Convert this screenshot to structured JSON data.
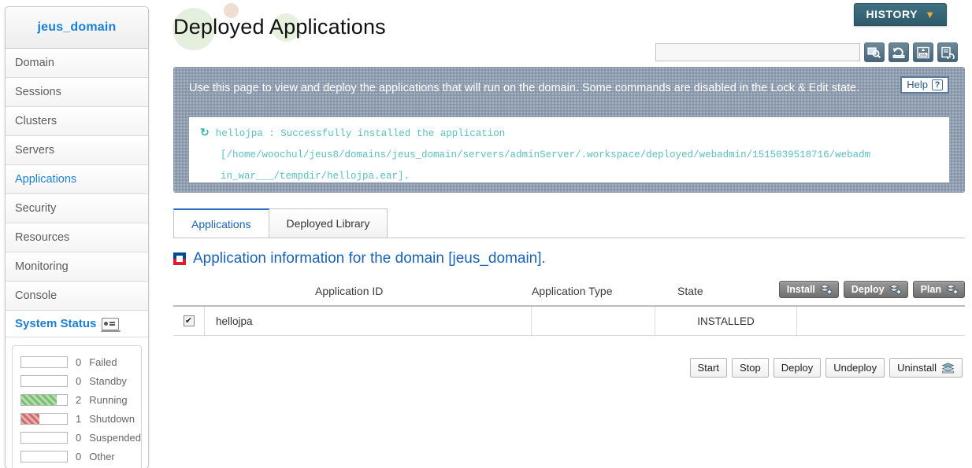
{
  "sidebar": {
    "domain_name": "jeus_domain",
    "items": [
      {
        "label": "Domain",
        "active": false
      },
      {
        "label": "Sessions",
        "active": false
      },
      {
        "label": "Clusters",
        "active": false
      },
      {
        "label": "Servers",
        "active": false
      },
      {
        "label": "Applications",
        "active": true
      },
      {
        "label": "Security",
        "active": false
      },
      {
        "label": "Resources",
        "active": false
      },
      {
        "label": "Monitoring",
        "active": false
      },
      {
        "label": "Console",
        "active": false
      }
    ],
    "system_status": {
      "title": "System Status",
      "rows": [
        {
          "count": "0",
          "label": "Failed",
          "fill_pct": 0,
          "color": ""
        },
        {
          "count": "0",
          "label": "Standby",
          "fill_pct": 0,
          "color": ""
        },
        {
          "count": "2",
          "label": "Running",
          "fill_pct": 78,
          "color": "green"
        },
        {
          "count": "1",
          "label": "Shutdown",
          "fill_pct": 40,
          "color": "red"
        },
        {
          "count": "0",
          "label": "Suspended",
          "fill_pct": 0,
          "color": ""
        },
        {
          "count": "0",
          "label": "Other",
          "fill_pct": 0,
          "color": ""
        }
      ]
    }
  },
  "header": {
    "title": "Deployed Applications",
    "history_label": "HISTORY",
    "history_chevron": "▼"
  },
  "toolbar": {
    "search_value": "",
    "search_placeholder": "",
    "icons": [
      "search-icon",
      "refresh-icon",
      "xml-export-icon",
      "backup-icon"
    ]
  },
  "info": {
    "description": "Use this page to view and deploy the applications that will run on the domain. Some commands are disabled in the Lock & Edit state.",
    "help_label": "Help",
    "help_glyph": "?",
    "message": {
      "status_glyph": "↻",
      "line1": "hellojpa : Successfully installed the application",
      "line2": "[/home/woochul/jeus8/domains/jeus_domain/servers/adminServer/.workspace/deployed/webadmin/1515039518716/webadm",
      "line3": "in_war___/tempdir/hellojpa.ear]."
    }
  },
  "tabs": [
    {
      "label": "Applications",
      "active": true
    },
    {
      "label": "Deployed Library",
      "active": false
    }
  ],
  "section": {
    "heading": "Application information for the domain [jeus_domain]."
  },
  "table": {
    "columns": [
      "Application ID",
      "Application Type",
      "State"
    ],
    "header_buttons": [
      {
        "label": "Install",
        "icon": "layers-plus-icon"
      },
      {
        "label": "Deploy",
        "icon": "layers-plus-icon"
      },
      {
        "label": "Plan",
        "icon": "layers-plus-icon"
      }
    ],
    "rows": [
      {
        "selected": true,
        "check_glyph": "✔",
        "app_id": "hellojpa",
        "app_type": "",
        "state": "INSTALLED"
      }
    ]
  },
  "footer_buttons": [
    {
      "label": "Start",
      "icon": ""
    },
    {
      "label": "Stop",
      "icon": ""
    },
    {
      "label": "Deploy",
      "icon": ""
    },
    {
      "label": "Undeploy",
      "icon": ""
    },
    {
      "label": "Uninstall",
      "icon": "layers-icon"
    }
  ],
  "colors": {
    "accent_blue": "#1b7fd4",
    "heading_blue": "#1b62b5",
    "panel_bg": "#8e9cb0",
    "message_text": "#5bbfbf",
    "history_bg": "#2e5a6b",
    "history_chevron": "#f0a93b",
    "running_green": "#76bf6e",
    "shutdown_red": "#cf6a6a"
  }
}
